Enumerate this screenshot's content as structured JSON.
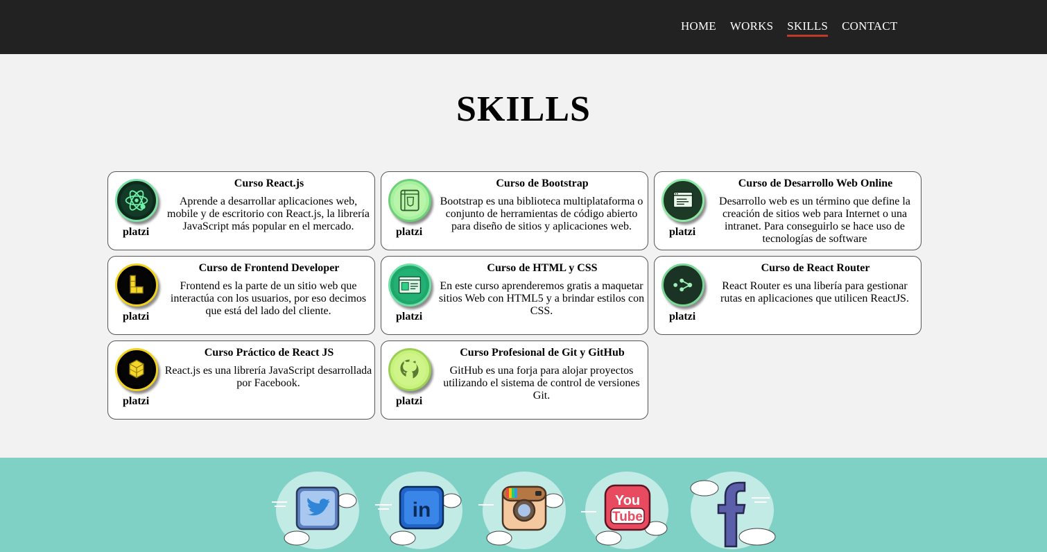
{
  "nav": {
    "items": [
      {
        "label": "HOME"
      },
      {
        "label": "WORKS"
      },
      {
        "label": "SKILLS"
      },
      {
        "label": "CONTACT"
      }
    ],
    "active": "SKILLS"
  },
  "page_title": "SKILLS",
  "cards": [
    {
      "title": "Curso React.js",
      "brand": "platzi",
      "icon": "react-atom-icon",
      "description": "Aprende a desarrollar aplicaciones web, mobile y de escritorio con React.js, la librería JavaScript más popular en el mercado."
    },
    {
      "title": "Curso de Bootstrap",
      "brand": "platzi",
      "icon": "bootstrap-icon",
      "description": "Bootstrap es una biblioteca multiplataforma o conjunto de herramientas de código abierto para diseño de sitios y aplicaciones web."
    },
    {
      "title": "Curso de Desarrollo Web Online",
      "brand": "platzi",
      "icon": "browser-window-icon",
      "description": "Desarrollo web es un término que define la creación de sitios web para Internet o una intranet. Para conseguirlo se hace uso de tecnologías de software"
    },
    {
      "title": "Curso de Frontend Developer",
      "brand": "platzi",
      "icon": "frontend-blocks-icon",
      "description": "Frontend es la parte de un sitio web que interactúa con los usuarios, por eso decimos que está del lado del cliente."
    },
    {
      "title": "Curso de HTML y CSS",
      "brand": "platzi",
      "icon": "html-css-icon",
      "description": "En este curso aprenderemos gratis a maquetar sitios Web con HTML5 y a brindar estilos con CSS."
    },
    {
      "title": "Curso de React Router",
      "brand": "platzi",
      "icon": "react-router-icon",
      "description": "React Router es una libería para gestionar rutas en aplicaciones que utilicen ReactJS."
    },
    {
      "title": "Curso Práctico de React JS",
      "brand": "platzi",
      "icon": "cube-blocks-icon",
      "description": "React.js es una librería JavaScript desarrollada por Facebook."
    },
    {
      "title": "Curso Profesional de Git y GitHub",
      "brand": "platzi",
      "icon": "github-icon",
      "description": "GitHub es una forja para alojar proyectos utilizando el sistema de control de versiones Git."
    }
  ],
  "footer": {
    "social": [
      {
        "icon": "twitter-icon"
      },
      {
        "icon": "linkedin-icon"
      },
      {
        "icon": "instagram-icon"
      },
      {
        "icon": "youtube-icon",
        "text_top": "You",
        "text_bottom": "Tube"
      },
      {
        "icon": "facebook-icon"
      }
    ]
  },
  "colors": {
    "header_bg": "#222222",
    "page_bg": "#f2f2f2",
    "footer_bg": "#7fd1c6",
    "active_underline": "#c0392b"
  }
}
